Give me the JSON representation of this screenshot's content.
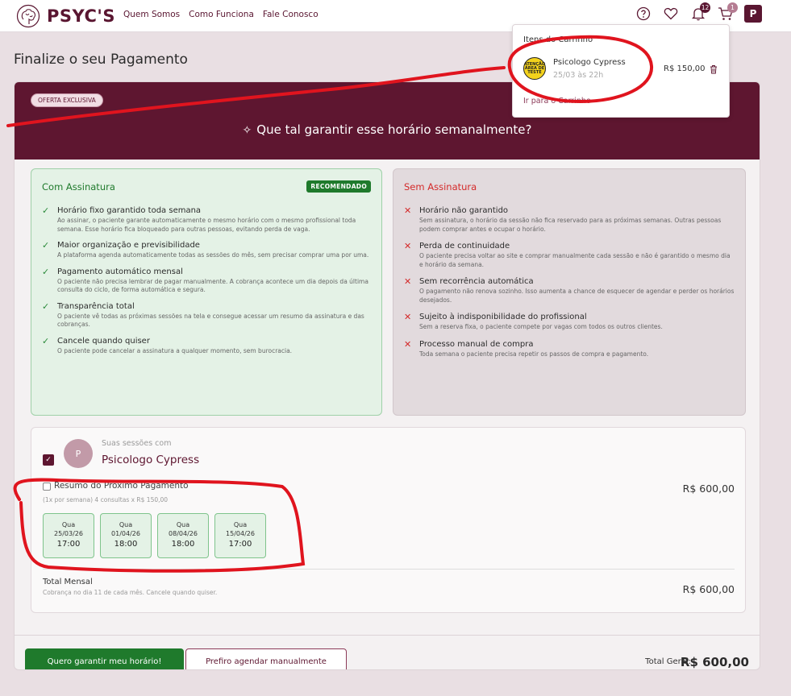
{
  "header": {
    "brand": "PSYC'S",
    "nav": [
      "Quem Somos",
      "Como Funciona",
      "Fale Conosco"
    ],
    "notifications_count": "12",
    "cart_count": "1",
    "user_initial": "P",
    "icons": [
      "help-icon",
      "heart-icon",
      "bell-icon",
      "cart-icon"
    ]
  },
  "page_title": "Finalize o seu Pagamento",
  "banner": {
    "pill": "OFERTA EXCLUSIVA",
    "title": "Que tal garantir esse horário semanalmente?"
  },
  "with_subscription": {
    "title": "Com Assinatura",
    "badge": "RECOMENDADO",
    "items": [
      {
        "title": "Horário fixo garantido toda semana",
        "desc": "Ao assinar, o paciente garante automaticamente o mesmo horário com o mesmo profissional toda semana. Esse horário fica bloqueado para outras pessoas, evitando perda de vaga."
      },
      {
        "title": "Maior organização e previsibilidade",
        "desc": "A plataforma agenda automaticamente todas as sessões do mês, sem precisar comprar uma por uma."
      },
      {
        "title": "Pagamento automático mensal",
        "desc": "O paciente não precisa lembrar de pagar manualmente. A cobrança acontece um dia depois da última consulta do ciclo, de forma automática e segura."
      },
      {
        "title": "Transparência total",
        "desc": "O paciente vê todas as próximas sessões na tela e consegue acessar um resumo da assinatura e das cobranças."
      },
      {
        "title": "Cancele quando quiser",
        "desc": "O paciente pode cancelar a assinatura a qualquer momento, sem burocracia."
      }
    ]
  },
  "without_subscription": {
    "title": "Sem Assinatura",
    "items": [
      {
        "title": "Horário não garantido",
        "desc": "Sem assinatura, o horário da sessão não fica reservado para as próximas semanas. Outras pessoas podem comprar antes e ocupar o horário."
      },
      {
        "title": "Perda de continuidade",
        "desc": "O paciente precisa voltar ao site e comprar manualmente cada sessão e não é garantido o mesmo dia e horário da semana."
      },
      {
        "title": "Sem recorrência automática",
        "desc": "O pagamento não renova sozinho. Isso aumenta a chance de esquecer de agendar e perder os horários desejados."
      },
      {
        "title": "Sujeito à indisponibilidade do profissional",
        "desc": "Sem a reserva fixa, o paciente compete por vagas com todos os outros clientes."
      },
      {
        "title": "Processo manual de compra",
        "desc": "Toda semana o paciente precisa repetir os passos de compra e pagamento."
      }
    ]
  },
  "sessions": {
    "subtitle": "Suas sessões com",
    "professional": "Psicologo Cypress",
    "avatar_initial": "P",
    "summary_title": "Resumo do Próximo Pagamento",
    "summary_sub": "(1x por semana) 4 consultas x R$ 150,00",
    "summary_price": "R$ 600,00",
    "dates": [
      {
        "day": "Qua",
        "date": "25/03/26",
        "time": "17:00"
      },
      {
        "day": "Qua",
        "date": "01/04/26",
        "time": "18:00"
      },
      {
        "day": "Qua",
        "date": "08/04/26",
        "time": "18:00"
      },
      {
        "day": "Qua",
        "date": "15/04/26",
        "time": "17:00"
      }
    ],
    "total_label": "Total Mensal",
    "total_sub": "Cobrança no dia 11 de cada mês. Cancele quando quiser.",
    "total_price": "R$ 600,00"
  },
  "footer": {
    "primary": "Quero garantir meu horário!",
    "secondary": "Prefiro agendar manualmente",
    "grand_label": "Total Geral:",
    "grand_value": "R$ 600,00"
  },
  "cart": {
    "title": "Itens do Carrinho",
    "thumb_text": [
      "ATENÇÃO",
      "ÁREA DE",
      "TESTE"
    ],
    "item_name": "Psicologo Cypress",
    "item_date": "25/03 às 22h",
    "item_price": "R$ 150,00",
    "link": "Ir para o Carrinho"
  },
  "colors": {
    "brand": "#5e1630",
    "success": "#1f7a2c",
    "danger": "#d42a2a",
    "annotation": "#e0141e"
  }
}
